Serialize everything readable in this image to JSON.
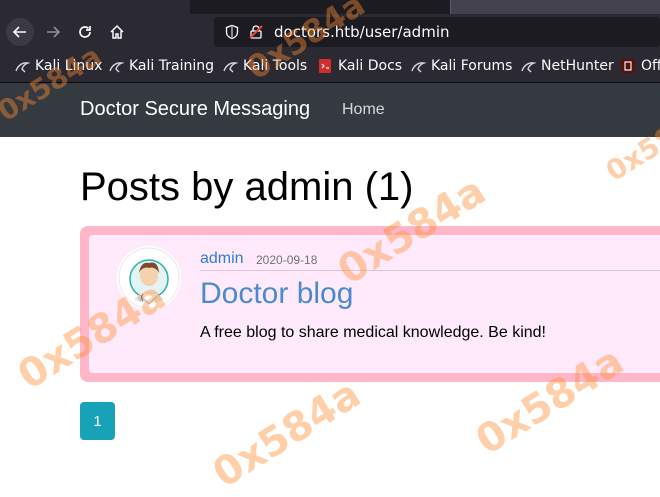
{
  "browser": {
    "url": "doctors.htb/user/admin",
    "bookmarks": [
      {
        "label": "Kali Linux",
        "icon": "kali-dragon-icon"
      },
      {
        "label": "Kali Training",
        "icon": "kali-dragon-icon"
      },
      {
        "label": "Kali Tools",
        "icon": "kali-dragon-icon"
      },
      {
        "label": "Kali Docs",
        "icon": "kali-docs-icon"
      },
      {
        "label": "Kali Forums",
        "icon": "kali-dragon-icon"
      },
      {
        "label": "NetHunter",
        "icon": "kali-dragon-icon"
      },
      {
        "label": "Off",
        "icon": "offensive-security-icon"
      }
    ]
  },
  "site": {
    "brand": "Doctor Secure Messaging",
    "nav_home": "Home"
  },
  "page": {
    "title": "Posts by admin (1)"
  },
  "post": {
    "author": "admin",
    "date": "2020-09-18",
    "title": "Doctor blog",
    "body": "A free blog to share medical knowledge. Be kind!",
    "avatar": "doctor-avatar-icon"
  },
  "pagination": {
    "current": "1"
  },
  "watermark": {
    "text": "0x584a",
    "color": "#ff8c32"
  },
  "colors": {
    "navbar": "#343a40",
    "card_border": "#ffb6c8",
    "card_bg": "#ffeafb",
    "link": "#2f7fd0",
    "page_button": "#17a2b8"
  }
}
